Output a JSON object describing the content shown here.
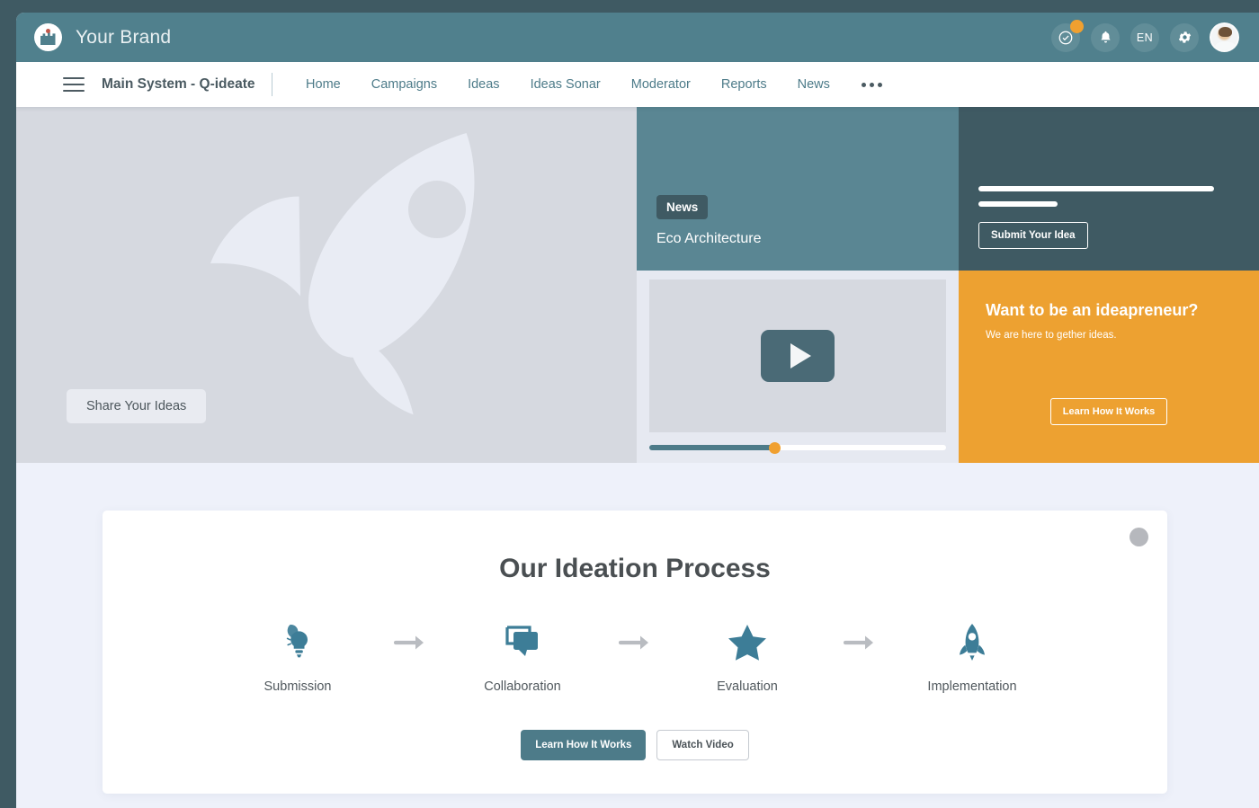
{
  "brand": {
    "name": "Your Brand",
    "logo_icon": "castle-logo-icon"
  },
  "topbar": {
    "tasks_icon": "check-circle-icon",
    "notifications_icon": "bell-icon",
    "language": "EN",
    "settings_icon": "gear-icon",
    "avatar_icon": "user-avatar",
    "badge_color": "#f0a030"
  },
  "nav": {
    "menu_icon": "hamburger-menu-icon",
    "system_title": "Main System - Q-ideate",
    "links": [
      {
        "label": "Home"
      },
      {
        "label": "Campaigns"
      },
      {
        "label": "Ideas"
      },
      {
        "label": "Ideas Sonar"
      },
      {
        "label": "Moderator"
      },
      {
        "label": "Reports"
      },
      {
        "label": "News"
      }
    ],
    "more_icon": "ellipsis-icon"
  },
  "hero": {
    "left": {
      "illustration_icon": "rocket-illustration",
      "cta_label": "Share Your Ideas"
    },
    "news": {
      "badge": "News",
      "title": "Eco Architecture"
    },
    "video": {
      "play_icon": "play-icon",
      "progress_percent": 42
    },
    "submit": {
      "button_label": "Submit Your Idea"
    },
    "promo": {
      "title": "Want to be an ideapreneur?",
      "subtitle": "We are here to gether ideas.",
      "button_label": "Learn How It Works",
      "background": "#eda131"
    }
  },
  "process": {
    "title": "Our Ideation Process",
    "menu_dot_icon": "card-menu-dot-icon",
    "steps": [
      {
        "label": "Submission",
        "icon": "lightbulbs-icon"
      },
      {
        "label": "Collaboration",
        "icon": "speech-bubbles-icon"
      },
      {
        "label": "Evaluation",
        "icon": "star-icon"
      },
      {
        "label": "Implementation",
        "icon": "rocket-icon"
      }
    ],
    "arrow_icon": "arrow-right-icon",
    "primary_button": "Learn How It Works",
    "secondary_button": "Watch Video"
  },
  "colors": {
    "brand_teal": "#50808d",
    "dark_teal": "#3f5a63",
    "accent_orange": "#eda131",
    "page_bg": "#eef1fa"
  }
}
